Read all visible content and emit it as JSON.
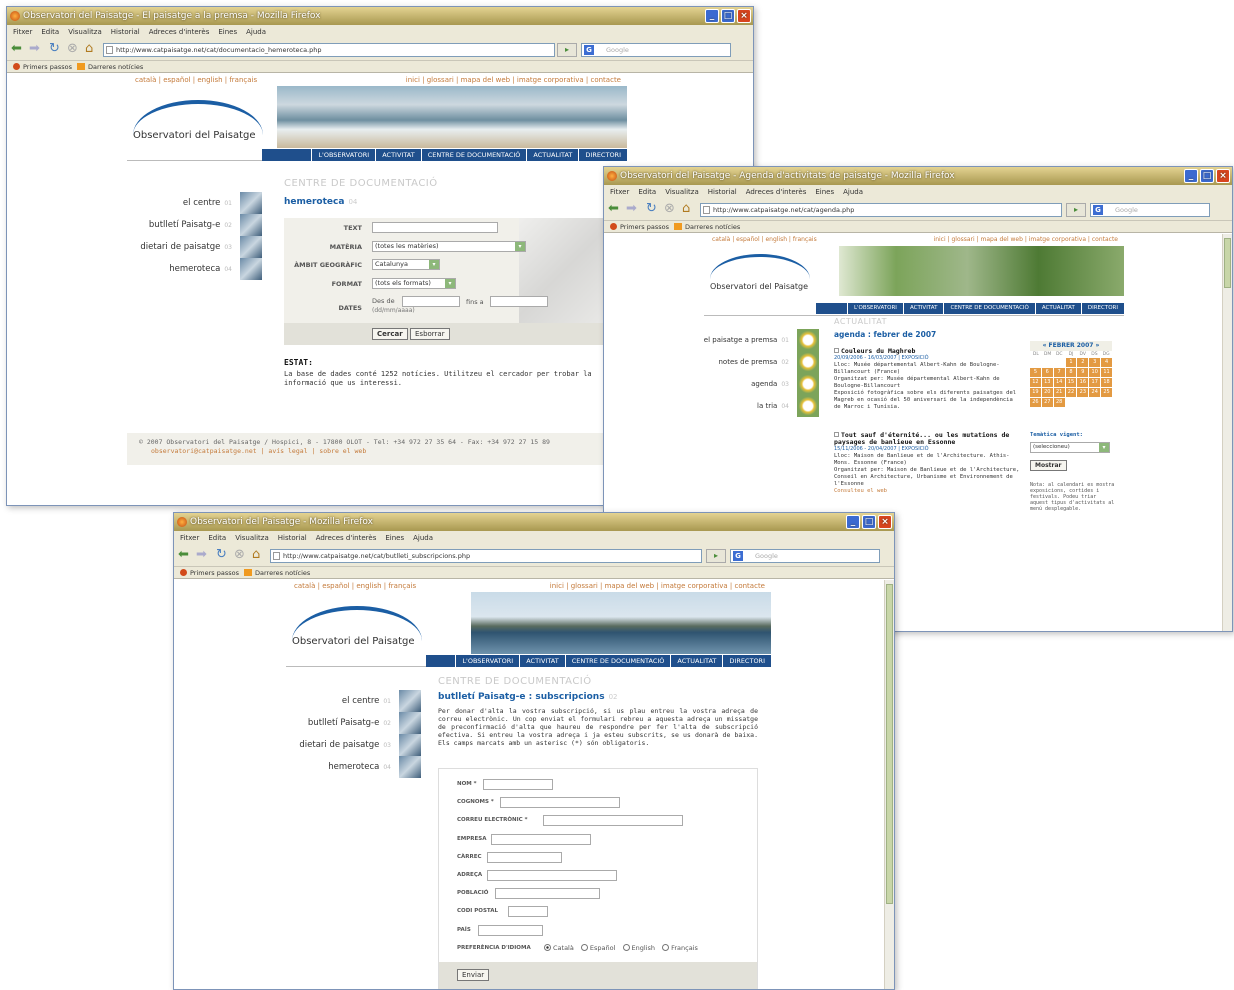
{
  "browser": {
    "menu": [
      "Fitxer",
      "Edita",
      "Visualitza",
      "Historial",
      "Adreces d'interès",
      "Eines",
      "Ajuda"
    ],
    "search_placeholder": "Google",
    "bookmarks": [
      "Primers passos",
      "Darreres notícies"
    ]
  },
  "site": {
    "logo": "Observatori del Paisatge",
    "langs": "català | español | english | français",
    "toplinks": "inici | glossari | mapa del web | imatge corporativa | contacte",
    "nav": [
      "L'OBSERVATORI",
      "ACTIVITAT",
      "CENTRE DE DOCUMENTACIÓ",
      "ACTUALITAT",
      "DIRECTORI"
    ]
  },
  "w1": {
    "title": "Observatori del Paisatge - El paisatge a la premsa - Mozilla Firefox",
    "url": "http://www.catpaisatge.net/cat/documentacio_hemeroteca.php",
    "section": "CENTRE DE DOCUMENTACIÓ",
    "subtitle": "hemeroteca",
    "subtitle_num": "04",
    "left": [
      {
        "label": "el centre",
        "num": "01"
      },
      {
        "label": "butlletí Paisatg-e",
        "num": "02"
      },
      {
        "label": "dietari de paisatge",
        "num": "03"
      },
      {
        "label": "hemeroteca",
        "num": "04"
      }
    ],
    "form": {
      "text_label": "TEXT",
      "materia_label": "MATÈRIA",
      "materia_value": "(totes les matèries)",
      "ambit_label": "ÀMBIT GEOGRÀFIC",
      "ambit_value": "Catalunya",
      "format_label": "FORMAT",
      "format_value": "(tots els formats)",
      "dates_label": "DATES",
      "des_de": "Des de",
      "date_hint": "(dd/mm/aaaa)",
      "fins_a": "fins a",
      "search_btn": "Cercar",
      "clear_btn": "Esborrar"
    },
    "state_title": "ESTAT:",
    "state_text": "La base de dades conté 1252 notícies. Utilitzeu el cercador per trobar la informació que us interessi.",
    "footer1": "© 2007 Observatori del Paisatge / Hospici, 8 - 17800 OLOT - Tel: +34 972 27 35 64 - Fax: +34 972 27 15 89",
    "footer_email": "observatori@catpaisatge.net",
    "footer_links": "| avís legal | sobre el web"
  },
  "w2": {
    "title": "Observatori del Paisatge - Agenda d'activitats de paisatge - Mozilla Firefox",
    "url": "http://www.catpaisatge.net/cat/agenda.php",
    "section": "ACTUALITAT",
    "subtitle": "agenda : febrer de 2007",
    "left": [
      {
        "label": "el paisatge a premsa",
        "num": "01"
      },
      {
        "label": "notes de premsa",
        "num": "02"
      },
      {
        "label": "agenda",
        "num": "03"
      },
      {
        "label": "la tria",
        "num": "04"
      }
    ],
    "events": [
      {
        "title": "Couleurs du Maghreb",
        "date": "20/09/2006 - 16/03/2007 | EXPOSICIÓ",
        "l1": "Lloc: Musée départemental Albert-Kahn de Boulogne-Billancourt (France)",
        "l2": "Organitzat per: Musée départemental Albert-Kahn de Boulogne-Billancourt",
        "l3": "Exposició fotogràfica sobre els diferents paisatges del Magreb en ocasió del 50 aniversari de la independència de Marroc i Tunísia."
      },
      {
        "title": "Tout sauf d'éternité... ou les mutations de paysages de banlieue en Essonne",
        "date": "15/11/2006 - 20/04/2007 | EXPOSICIÓ",
        "l1": "Lloc: Maison de Banlieue et de l'Architecture. Athis-Mons. Essonne (France)",
        "l2": "Organitzat per: Maison de Banlieue et de l'Architecture, Conseil en Architecture, Urbanisme et Environnement de l'Essonne",
        "l3": "Consulteu el web"
      }
    ],
    "cal_title": "FEBRER 2007",
    "cal_days": [
      "DL",
      "DM",
      "DC",
      "DJ",
      "DV",
      "DS",
      "DG"
    ],
    "cal_cells": [
      "",
      "",
      "",
      "1",
      "2",
      "3",
      "4",
      "5",
      "6",
      "7",
      "8",
      "9",
      "10",
      "11",
      "12",
      "13",
      "14",
      "15",
      "16",
      "17",
      "18",
      "19",
      "20",
      "21",
      "22",
      "23",
      "24",
      "25",
      "26",
      "27",
      "28",
      "",
      "",
      "",
      ""
    ],
    "tem_label": "Temàtica vigent:",
    "tem_value": "(seleccioneu)",
    "show_btn": "Mostrar",
    "note": "Nota: al calendari es mostra exposicions, cortides i festivals. Podeu triar aquest tipus d'activitats al menú desplegable."
  },
  "w3": {
    "title": "Observatori del Paisatge - Mozilla Firefox",
    "url": "http://www.catpaisatge.net/cat/butlleti_subscripcions.php",
    "section": "CENTRE DE DOCUMENTACIÓ",
    "subtitle": "butlletí Paisatg-e : subscripcions",
    "subtitle_num": "02",
    "left": [
      {
        "label": "el centre",
        "num": "01"
      },
      {
        "label": "butlletí Paisatg-e",
        "num": "02"
      },
      {
        "label": "dietari de paisatge",
        "num": "03"
      },
      {
        "label": "hemeroteca",
        "num": "04"
      }
    ],
    "intro": "Per donar d'alta la vostra subscripció, si us plau entreu la vostra adreça de correu electrònic. Un cop enviat el formulari rebreu a aquesta adreça un missatge de preconfirmació d'alta que haureu de respondre per fer l'alta de subscripció efectiva. Si entreu la vostra adreça i ja esteu subscrits, se us donarà de baixa. Els camps marcats amb un asterisc (*) són obligatoris.",
    "fields": [
      "NOM *",
      "COGNOMS *",
      "CORREU ELECTRÒNIC *",
      "EMPRESA",
      "CÀRREC",
      "ADREÇA",
      "POBLACIÓ",
      "CODI POSTAL",
      "PAÍS"
    ],
    "lang_pref": "PREFERÈNCIA D'IDIOMA",
    "lang_opts": [
      "Català",
      "Español",
      "English",
      "Français"
    ],
    "submit": "Enviar"
  }
}
